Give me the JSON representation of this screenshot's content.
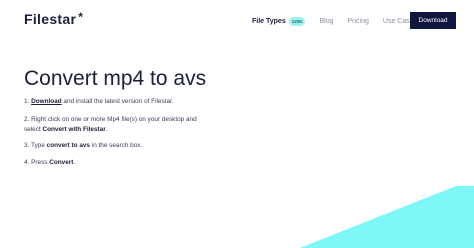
{
  "header": {
    "logo": "Filestar",
    "logo_mark": "*",
    "nav": {
      "file_types": "File Types",
      "file_types_badge": "120K",
      "blog": "Blog",
      "pricing": "Pricing",
      "use_cases": "Use Cases"
    },
    "download_button": "Download"
  },
  "main": {
    "title": "Convert mp4 to avs",
    "steps": [
      {
        "num": "1.",
        "link": "Download",
        "text": " and install the latest version of Filestar."
      },
      {
        "num": "2.",
        "text_a": "Right click on one or more Mp4 file(s) on your desktop and",
        "text_b": "select ",
        "bold": "Convert with Filestar",
        "text_c": "."
      },
      {
        "num": "3.",
        "text_a": "Type ",
        "bold": "convert to avs",
        "text_c": " in the search box."
      },
      {
        "num": "4.",
        "text_a": "Press ",
        "bold": "Convert",
        "text_c": "."
      }
    ]
  },
  "colors": {
    "brand_navy": "#11163f",
    "accent_cyan": "#7ef7f7",
    "badge_bg": "#9ff0ee"
  }
}
